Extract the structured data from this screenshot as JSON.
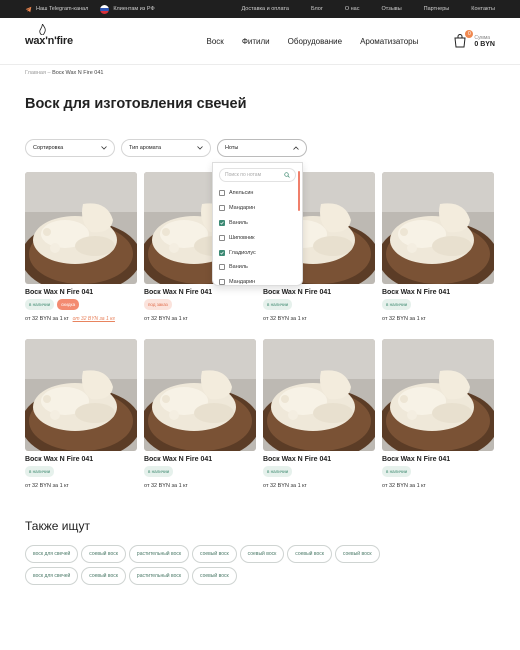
{
  "topbar": {
    "telegram": "Наш Telegram-канал",
    "russia": "Клиентам из РФ",
    "links": [
      "Доставка и оплата",
      "Блог",
      "О нас",
      "Отзывы",
      "Партнеры",
      "Контакты"
    ]
  },
  "header": {
    "logo": "wax'n'fire",
    "nav": [
      "Воск",
      "Фитили",
      "Оборудование",
      "Ароматизаторы"
    ],
    "cart": {
      "count": "0",
      "label": "Сумма",
      "sum": "0 BYN"
    }
  },
  "breadcrumb": {
    "home": "Главная",
    "separator": "–",
    "current": "Воск Wax N Fire 041"
  },
  "page_title": "Воск для изготовления свечей",
  "filters": {
    "sort": "Сортировка",
    "aroma_type": "Тип аромата",
    "notes": "Ноты",
    "notes_search_placeholder": "Поиск по нотам",
    "notes_options": [
      {
        "label": "Апельсин",
        "checked": false
      },
      {
        "label": "Мандарин",
        "checked": false
      },
      {
        "label": "Ваниль",
        "checked": true
      },
      {
        "label": "Шиповник",
        "checked": false
      },
      {
        "label": "Гладиолус",
        "checked": true
      },
      {
        "label": "Ваниль",
        "checked": false
      },
      {
        "label": "Мандарин",
        "checked": false
      }
    ]
  },
  "products": [
    {
      "name": "Воск Wax N Fire 041",
      "badges": [
        {
          "text": "в наличии",
          "kind": "in"
        },
        {
          "text": "скидка",
          "kind": "sale"
        }
      ],
      "price": "от 32 BYN за 1 кг",
      "old_price": "от 32 BYN за 1 кг"
    },
    {
      "name": "Воск Wax N Fire 041",
      "badges": [
        {
          "text": "под заказ",
          "kind": "order"
        }
      ],
      "price": "от 32 BYN за 1 кг",
      "old_price": ""
    },
    {
      "name": "Воск Wax N Fire 041",
      "badges": [
        {
          "text": "в наличии",
          "kind": "in"
        }
      ],
      "price": "от 32 BYN за 1 кг",
      "old_price": ""
    },
    {
      "name": "Воск Wax N Fire 041",
      "badges": [
        {
          "text": "в наличии",
          "kind": "in"
        }
      ],
      "price": "от 32 BYN за 1 кг",
      "old_price": ""
    },
    {
      "name": "Воск Wax N Fire 041",
      "badges": [
        {
          "text": "в наличии",
          "kind": "in"
        }
      ],
      "price": "от 32 BYN за 1 кг",
      "old_price": ""
    },
    {
      "name": "Воск Wax N Fire 041",
      "badges": [
        {
          "text": "в наличии",
          "kind": "in"
        }
      ],
      "price": "от 32 BYN за 1 кг",
      "old_price": ""
    },
    {
      "name": "Воск Wax N Fire 041",
      "badges": [
        {
          "text": "в наличии",
          "kind": "in"
        }
      ],
      "price": "от 32 BYN за 1 кг",
      "old_price": ""
    },
    {
      "name": "Воск Wax N Fire 041",
      "badges": [
        {
          "text": "в наличии",
          "kind": "in"
        }
      ],
      "price": "от 32 BYN за 1 кг",
      "old_price": ""
    }
  ],
  "also_search": {
    "title": "Также ищут",
    "tags": [
      "воск для свечей",
      "соевый воск",
      "растительный воск",
      "соевый воск",
      "соевый воск",
      "соевый воск",
      "соевый воск",
      "воск для свечей",
      "соевый воск",
      "растительный воск",
      "соевый воск"
    ]
  },
  "colors": {
    "accent": "#f0884f",
    "in_stock": "#3e8a70",
    "topbar": "#1f1f1f"
  },
  "icons": [
    "telegram-icon",
    "russia-flag-icon",
    "cart-icon",
    "chevron-down-icon",
    "chevron-up-icon",
    "search-icon",
    "checkbox-icon",
    "flame-icon"
  ]
}
